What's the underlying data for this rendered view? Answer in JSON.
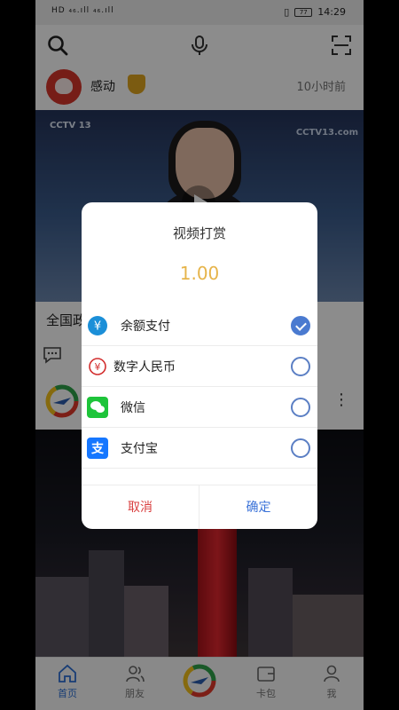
{
  "status_bar": {
    "carrier": "HD ₄₆.ıll ₄₆.ıll",
    "battery": "77",
    "time": "14:29"
  },
  "feed": {
    "author": "感动",
    "time_ago": "10小时前",
    "caption": "全国政"
  },
  "video": {
    "logo_left": "CCTV 13",
    "logo_right": "CCTV13.com"
  },
  "dialog": {
    "title": "视频打赏",
    "amount": "1.00",
    "options": [
      {
        "label": "余额支付",
        "icon": "yuan-balance-icon",
        "checked": true
      },
      {
        "label": "数字人民币",
        "icon": "digital-rmb-icon",
        "checked": false
      },
      {
        "label": "微信",
        "icon": "wechat-icon",
        "checked": false
      },
      {
        "label": "支付宝",
        "icon": "alipay-icon",
        "checked": false
      }
    ],
    "cancel": "取消",
    "confirm": "确定"
  },
  "tabs": [
    {
      "label": "首页",
      "icon": "home-icon",
      "active": true
    },
    {
      "label": "朋友",
      "icon": "friends-icon",
      "active": false
    },
    {
      "label": "",
      "icon": "cctv-app-icon",
      "active": false
    },
    {
      "label": "卡包",
      "icon": "wallet-icon",
      "active": false
    },
    {
      "label": "我",
      "icon": "profile-icon",
      "active": false
    }
  ],
  "colors": {
    "accent": "#3a72d8",
    "amount": "#e6b44a",
    "cancel": "#d94040",
    "overlay": "rgba(0,0,0,0.45)"
  }
}
